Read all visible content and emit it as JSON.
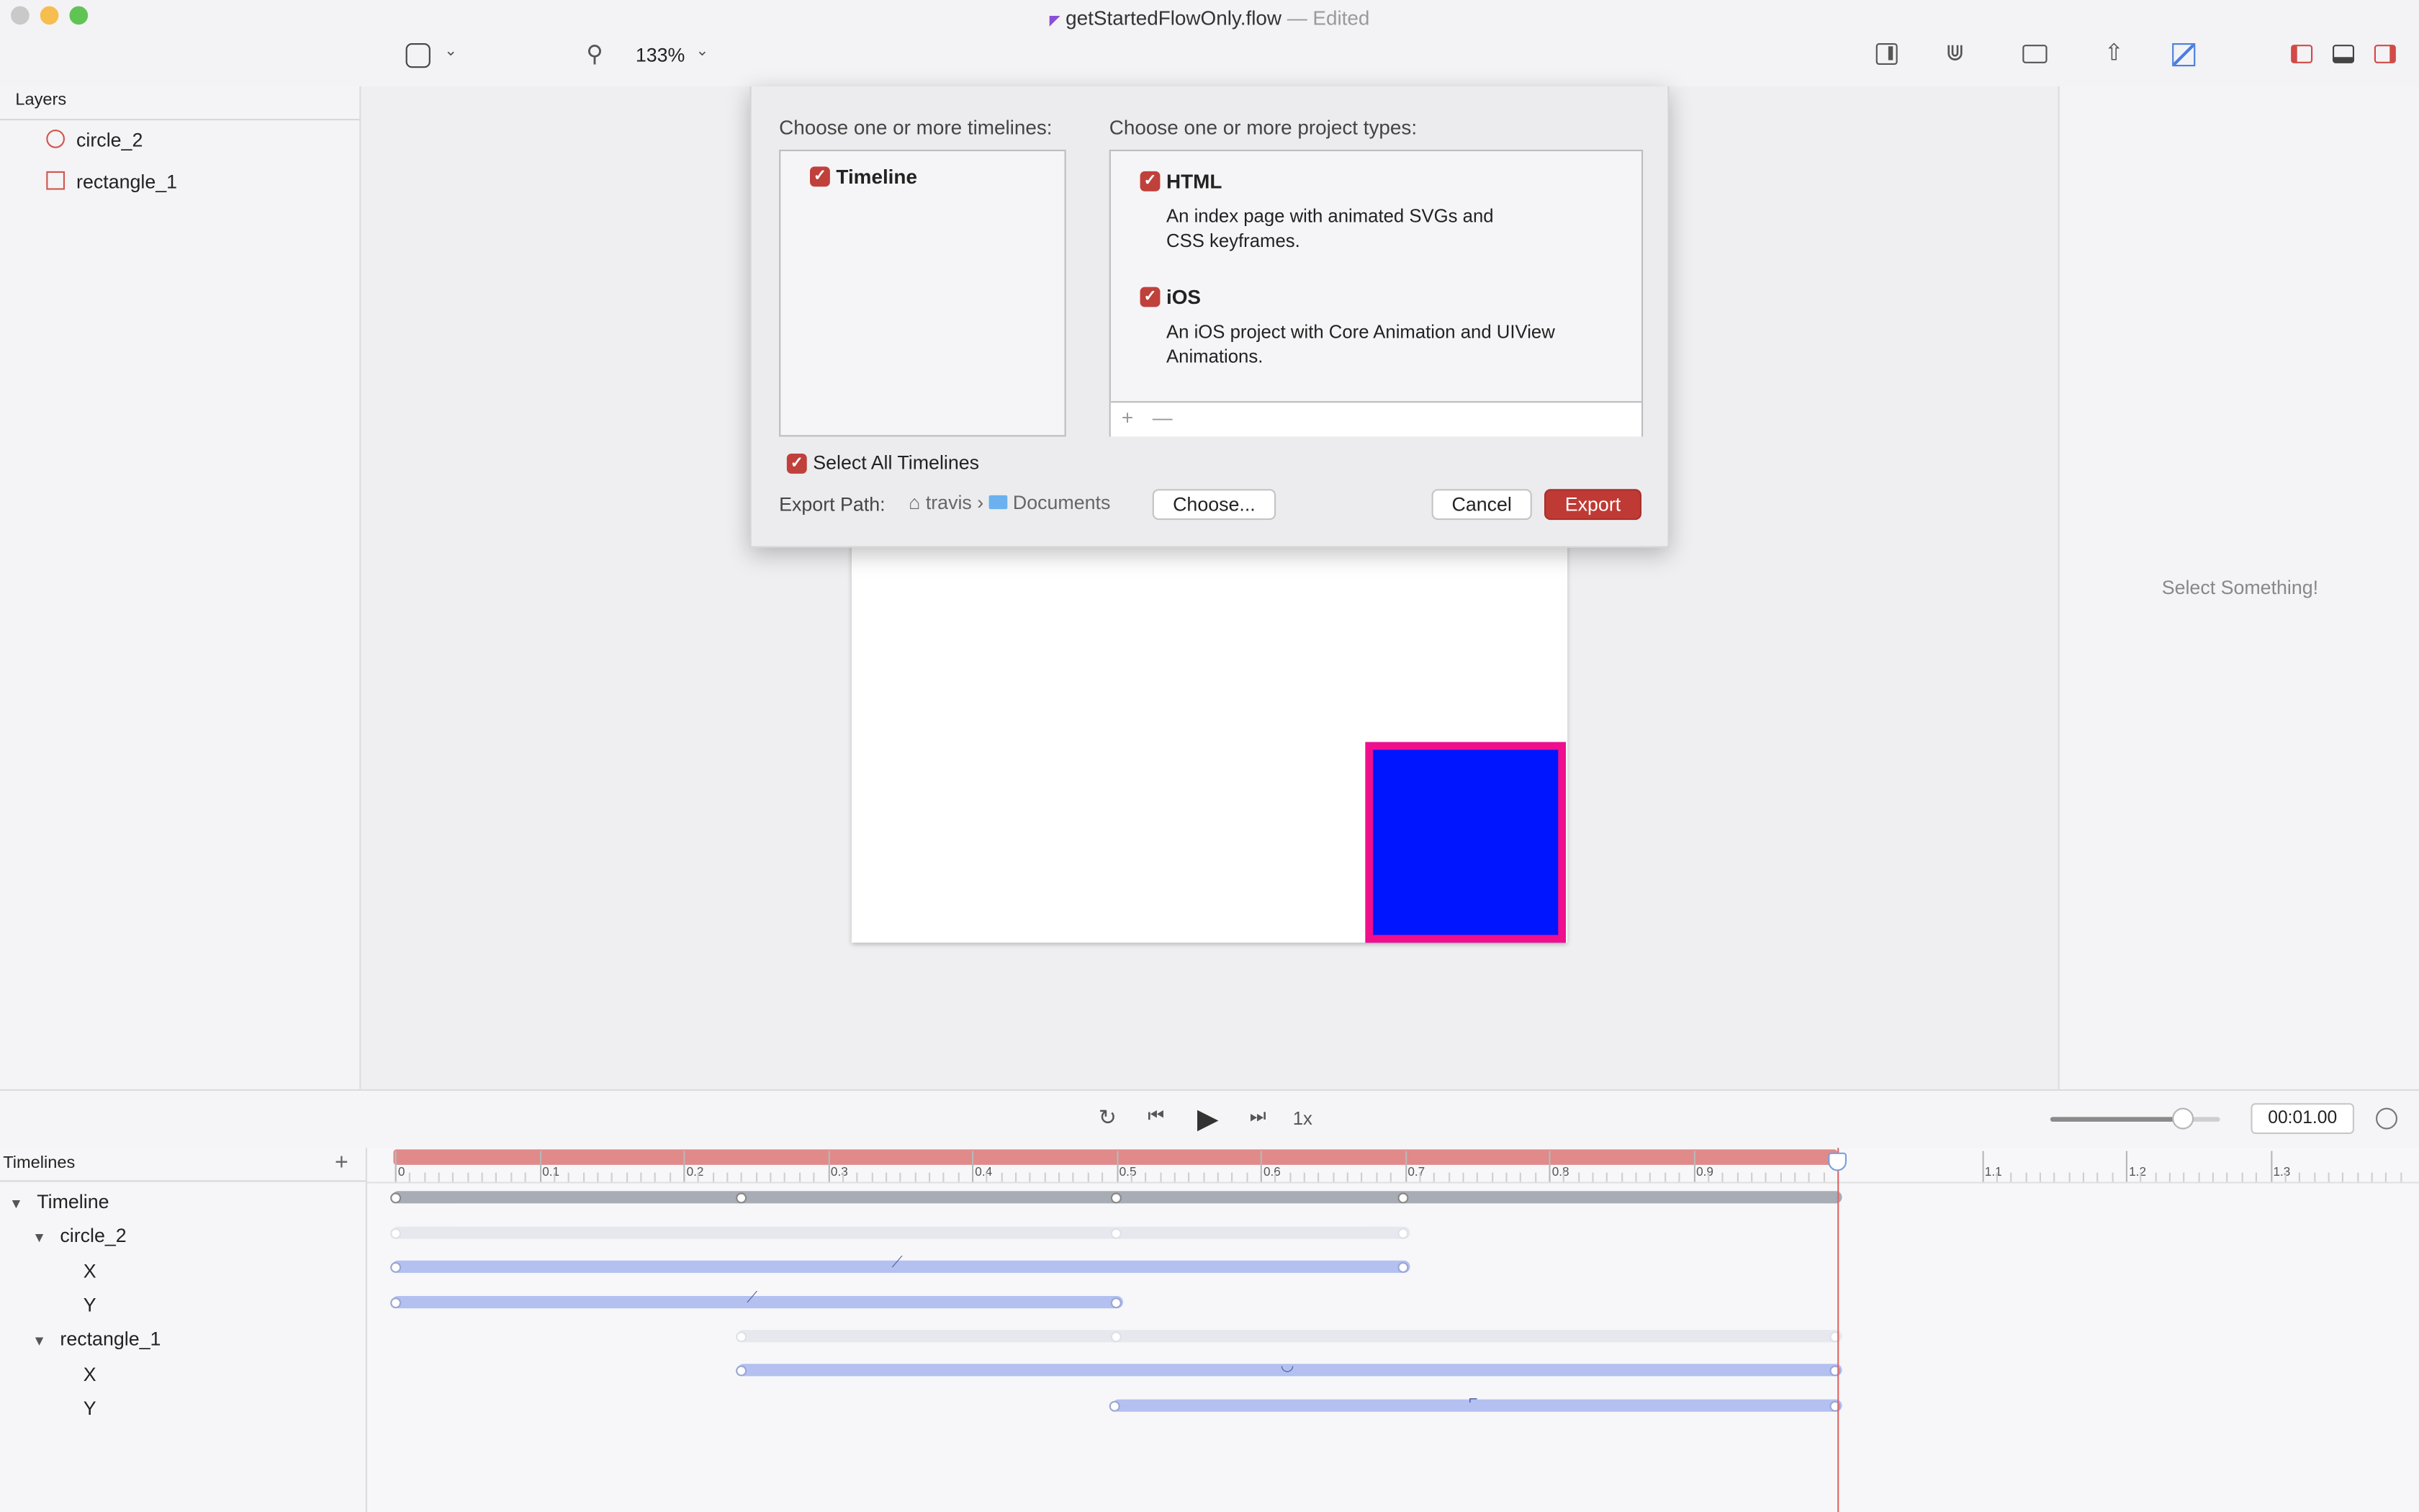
{
  "window": {
    "title": "getStartedFlowOnly.flow",
    "edited": "— Edited"
  },
  "toolbar": {
    "zoom": "133%"
  },
  "layers": {
    "header": "Layers",
    "items": [
      {
        "name": "circle_2"
      },
      {
        "name": "rectangle_1"
      }
    ]
  },
  "inspector": {
    "placeholder": "Select Something!"
  },
  "sheet": {
    "timelines_label": "Choose one or more timelines:",
    "timeline_item": "Timeline",
    "types_label": "Choose one or more project types:",
    "types": [
      {
        "name": "HTML",
        "desc1": "An index page with animated SVGs and",
        "desc2": "CSS keyframes."
      },
      {
        "name": "iOS",
        "desc1": "An iOS project with Core Animation and UIView",
        "desc2": "Animations."
      }
    ],
    "add": "+",
    "remove": "—",
    "select_all": "Select All Timelines",
    "export_path_label": "Export Path:",
    "path_home": "travis",
    "path_sep": "›",
    "path_folder": "Documents",
    "choose": "Choose...",
    "cancel": "Cancel",
    "export": "Export"
  },
  "transport": {
    "speed": "1x",
    "time": "00:01.00",
    "zoom_level": 0.78
  },
  "timelines": {
    "header": "Timelines",
    "add": "+",
    "rows": [
      {
        "label": "Timeline"
      },
      {
        "label": "circle_2"
      },
      {
        "label": "X"
      },
      {
        "label": "Y"
      },
      {
        "label": "rectangle_1"
      },
      {
        "label": "X"
      },
      {
        "label": "Y"
      }
    ],
    "ticks": [
      "0",
      "0.1",
      "0.2",
      "0.3",
      "0.4",
      "0.5",
      "0.6",
      "0.7",
      "0.8",
      "0.9",
      "1.1",
      "1.2",
      "1.3"
    ],
    "playhead_time": 1.0,
    "colors": {
      "playback_range": "#e08a8a",
      "timeline_bar": "#a7acb5",
      "property_bar": "#b3c0f0",
      "group_bar": "#e6e8ee",
      "playhead": "#e06565"
    }
  }
}
